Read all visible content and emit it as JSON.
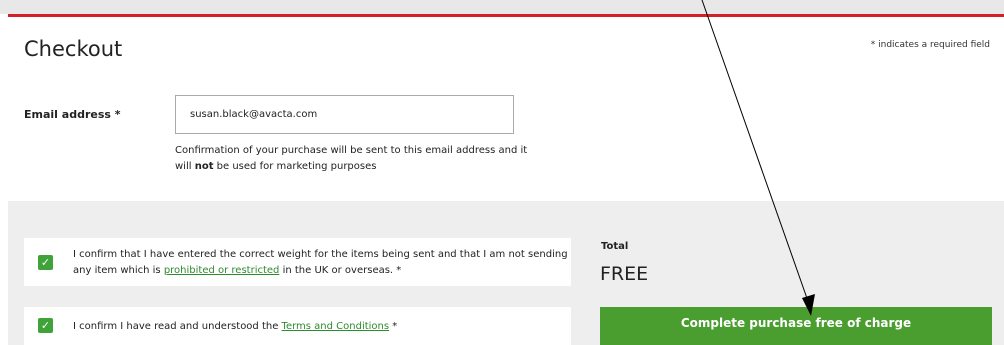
{
  "header": {
    "title": "Checkout",
    "required_note": "* indicates a required field"
  },
  "email": {
    "label": "Email address *",
    "value": "susan.black@avacta.com",
    "help_part1": "Confirmation of your purchase will be sent to this email address and it will ",
    "help_bold": "not",
    "help_part2": " be used for marketing purposes"
  },
  "confirmations": [
    {
      "checked": true,
      "text_before": "I confirm that I have entered the correct weight for the items being sent and that I am not sending any item which is ",
      "link_text": "prohibited or restricted",
      "text_after": " in the UK or overseas. *"
    },
    {
      "checked": true,
      "text_before": "I confirm I have read and understood the ",
      "link_text": "Terms and Conditions",
      "text_after": " *"
    }
  ],
  "summary": {
    "total_label": "Total",
    "total_value": "FREE",
    "complete_button": "Complete purchase free of charge"
  },
  "icons": {
    "checkmark": "check-icon",
    "annotation": "arrow-annotation"
  },
  "colors": {
    "accent_red": "#d4202a",
    "primary_green": "#4a9d2f",
    "checkbox_green": "#3fa33a",
    "link_green": "#2e8b2e"
  }
}
